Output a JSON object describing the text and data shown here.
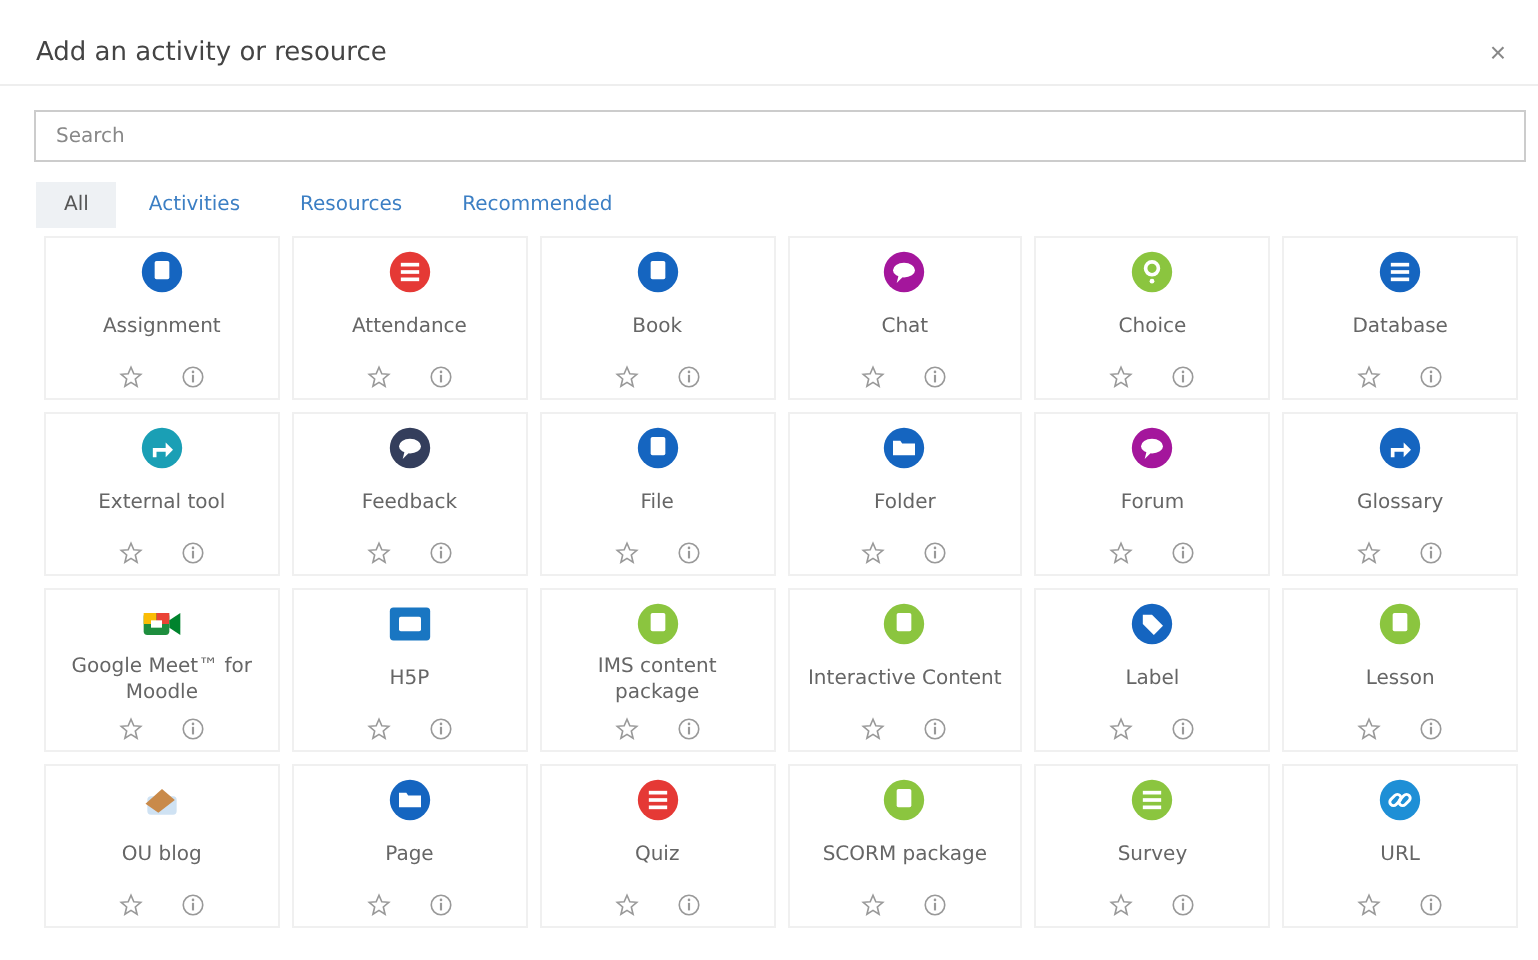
{
  "dialog": {
    "title": "Add an activity or resource",
    "close": "×"
  },
  "search": {
    "placeholder": "Search"
  },
  "tabs": [
    {
      "label": "All",
      "selected": true
    },
    {
      "label": "Activities",
      "selected": false
    },
    {
      "label": "Resources",
      "selected": false
    },
    {
      "label": "Recommended",
      "selected": false
    }
  ],
  "items": [
    {
      "label": "Assignment",
      "kind": "doc",
      "color": "#1565c0"
    },
    {
      "label": "Attendance",
      "kind": "list",
      "color": "#e53935"
    },
    {
      "label": "Book",
      "kind": "doc",
      "color": "#1565c0"
    },
    {
      "label": "Chat",
      "kind": "bubble",
      "color": "#a4169c"
    },
    {
      "label": "Choice",
      "kind": "question",
      "color": "#8bc53f"
    },
    {
      "label": "Database",
      "kind": "list",
      "color": "#1565c0"
    },
    {
      "label": "External tool",
      "kind": "arrow",
      "color": "#1a9fb5"
    },
    {
      "label": "Feedback",
      "kind": "bubble",
      "color": "#343e5c"
    },
    {
      "label": "File",
      "kind": "doc",
      "color": "#1565c0"
    },
    {
      "label": "Folder",
      "kind": "folder",
      "color": "#1565c0"
    },
    {
      "label": "Forum",
      "kind": "bubble",
      "color": "#a4169c"
    },
    {
      "label": "Glossary",
      "kind": "arrow",
      "color": "#1565c0"
    },
    {
      "label": "Google Meet™ for Moodle",
      "kind": "camera",
      "color": "#1e8e3e"
    },
    {
      "label": "H5P",
      "kind": "square",
      "color": "#1976c2"
    },
    {
      "label": "IMS content package",
      "kind": "doc",
      "color": "#8bc53f"
    },
    {
      "label": "Interactive Content",
      "kind": "doc",
      "color": "#8bc53f"
    },
    {
      "label": "Label",
      "kind": "tag",
      "color": "#1565c0"
    },
    {
      "label": "Lesson",
      "kind": "doc",
      "color": "#8bc53f"
    },
    {
      "label": "OU blog",
      "kind": "blog",
      "color": "#c98a4a"
    },
    {
      "label": "Page",
      "kind": "folder",
      "color": "#1565c0"
    },
    {
      "label": "Quiz",
      "kind": "list",
      "color": "#e53935"
    },
    {
      "label": "SCORM package",
      "kind": "doc",
      "color": "#8bc53f"
    },
    {
      "label": "Survey",
      "kind": "list",
      "color": "#8bc53f"
    },
    {
      "label": "URL",
      "kind": "link",
      "color": "#1e8fd6"
    }
  ]
}
